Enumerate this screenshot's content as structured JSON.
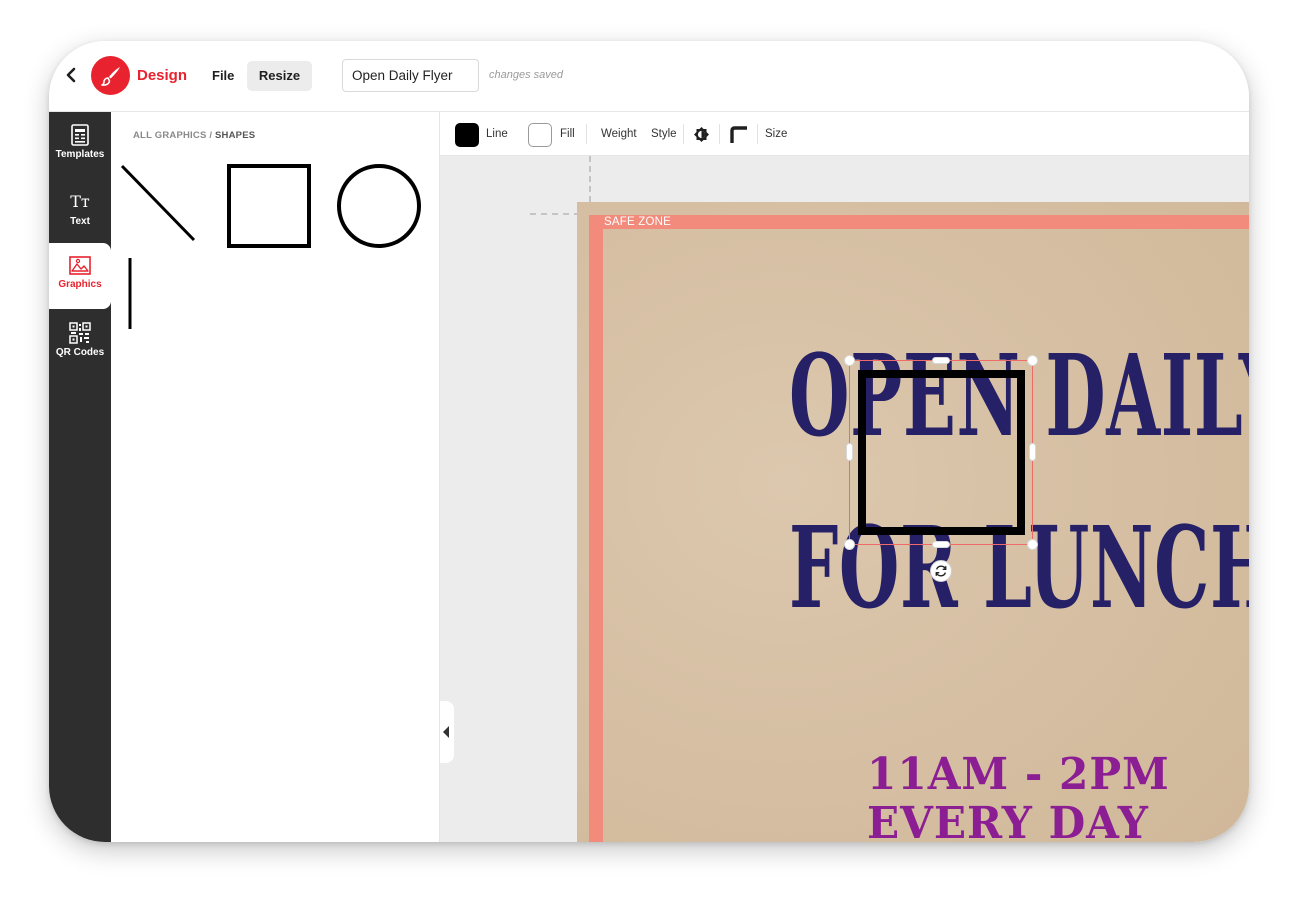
{
  "header": {
    "brand": "Design",
    "menu": {
      "file": "File",
      "resize": "Resize"
    },
    "document_title": "Open Daily Flyer",
    "save_status": "changes saved"
  },
  "sidebar": {
    "items": [
      {
        "label": "Templates",
        "icon": "templates-icon",
        "active": false
      },
      {
        "label": "Text",
        "icon": "text-icon",
        "active": false
      },
      {
        "label": "Graphics",
        "icon": "graphics-icon",
        "active": true
      },
      {
        "label": "QR Codes",
        "icon": "qr-code-icon",
        "active": false
      }
    ],
    "text_icon_glyph": "Tт"
  },
  "panel": {
    "breadcrumb": {
      "root": "ALL GRAPHICS",
      "separator": " / ",
      "current": "SHAPES"
    },
    "shapes": [
      "diagonal-line",
      "square",
      "circle",
      "vertical-line"
    ]
  },
  "toolbar": {
    "line_label": "Line",
    "fill_label": "Fill",
    "weight_label": "Weight",
    "style_label": "Style",
    "size_label": "Size",
    "line_color": "#000000",
    "fill_color": "#ffffff"
  },
  "canvas": {
    "safe_zone_label": "SAFE ZONE",
    "headline_line1": "OPEN DAILY",
    "headline_line2": "FOR LUNCH",
    "hours": "11AM - 2PM",
    "days": "EVERY DAY"
  },
  "colors": {
    "brand": "#e8232f",
    "headline": "#262166",
    "subhead": "#8c1e93",
    "bleed": "#f28b7c",
    "selection": "#f06a6a"
  }
}
